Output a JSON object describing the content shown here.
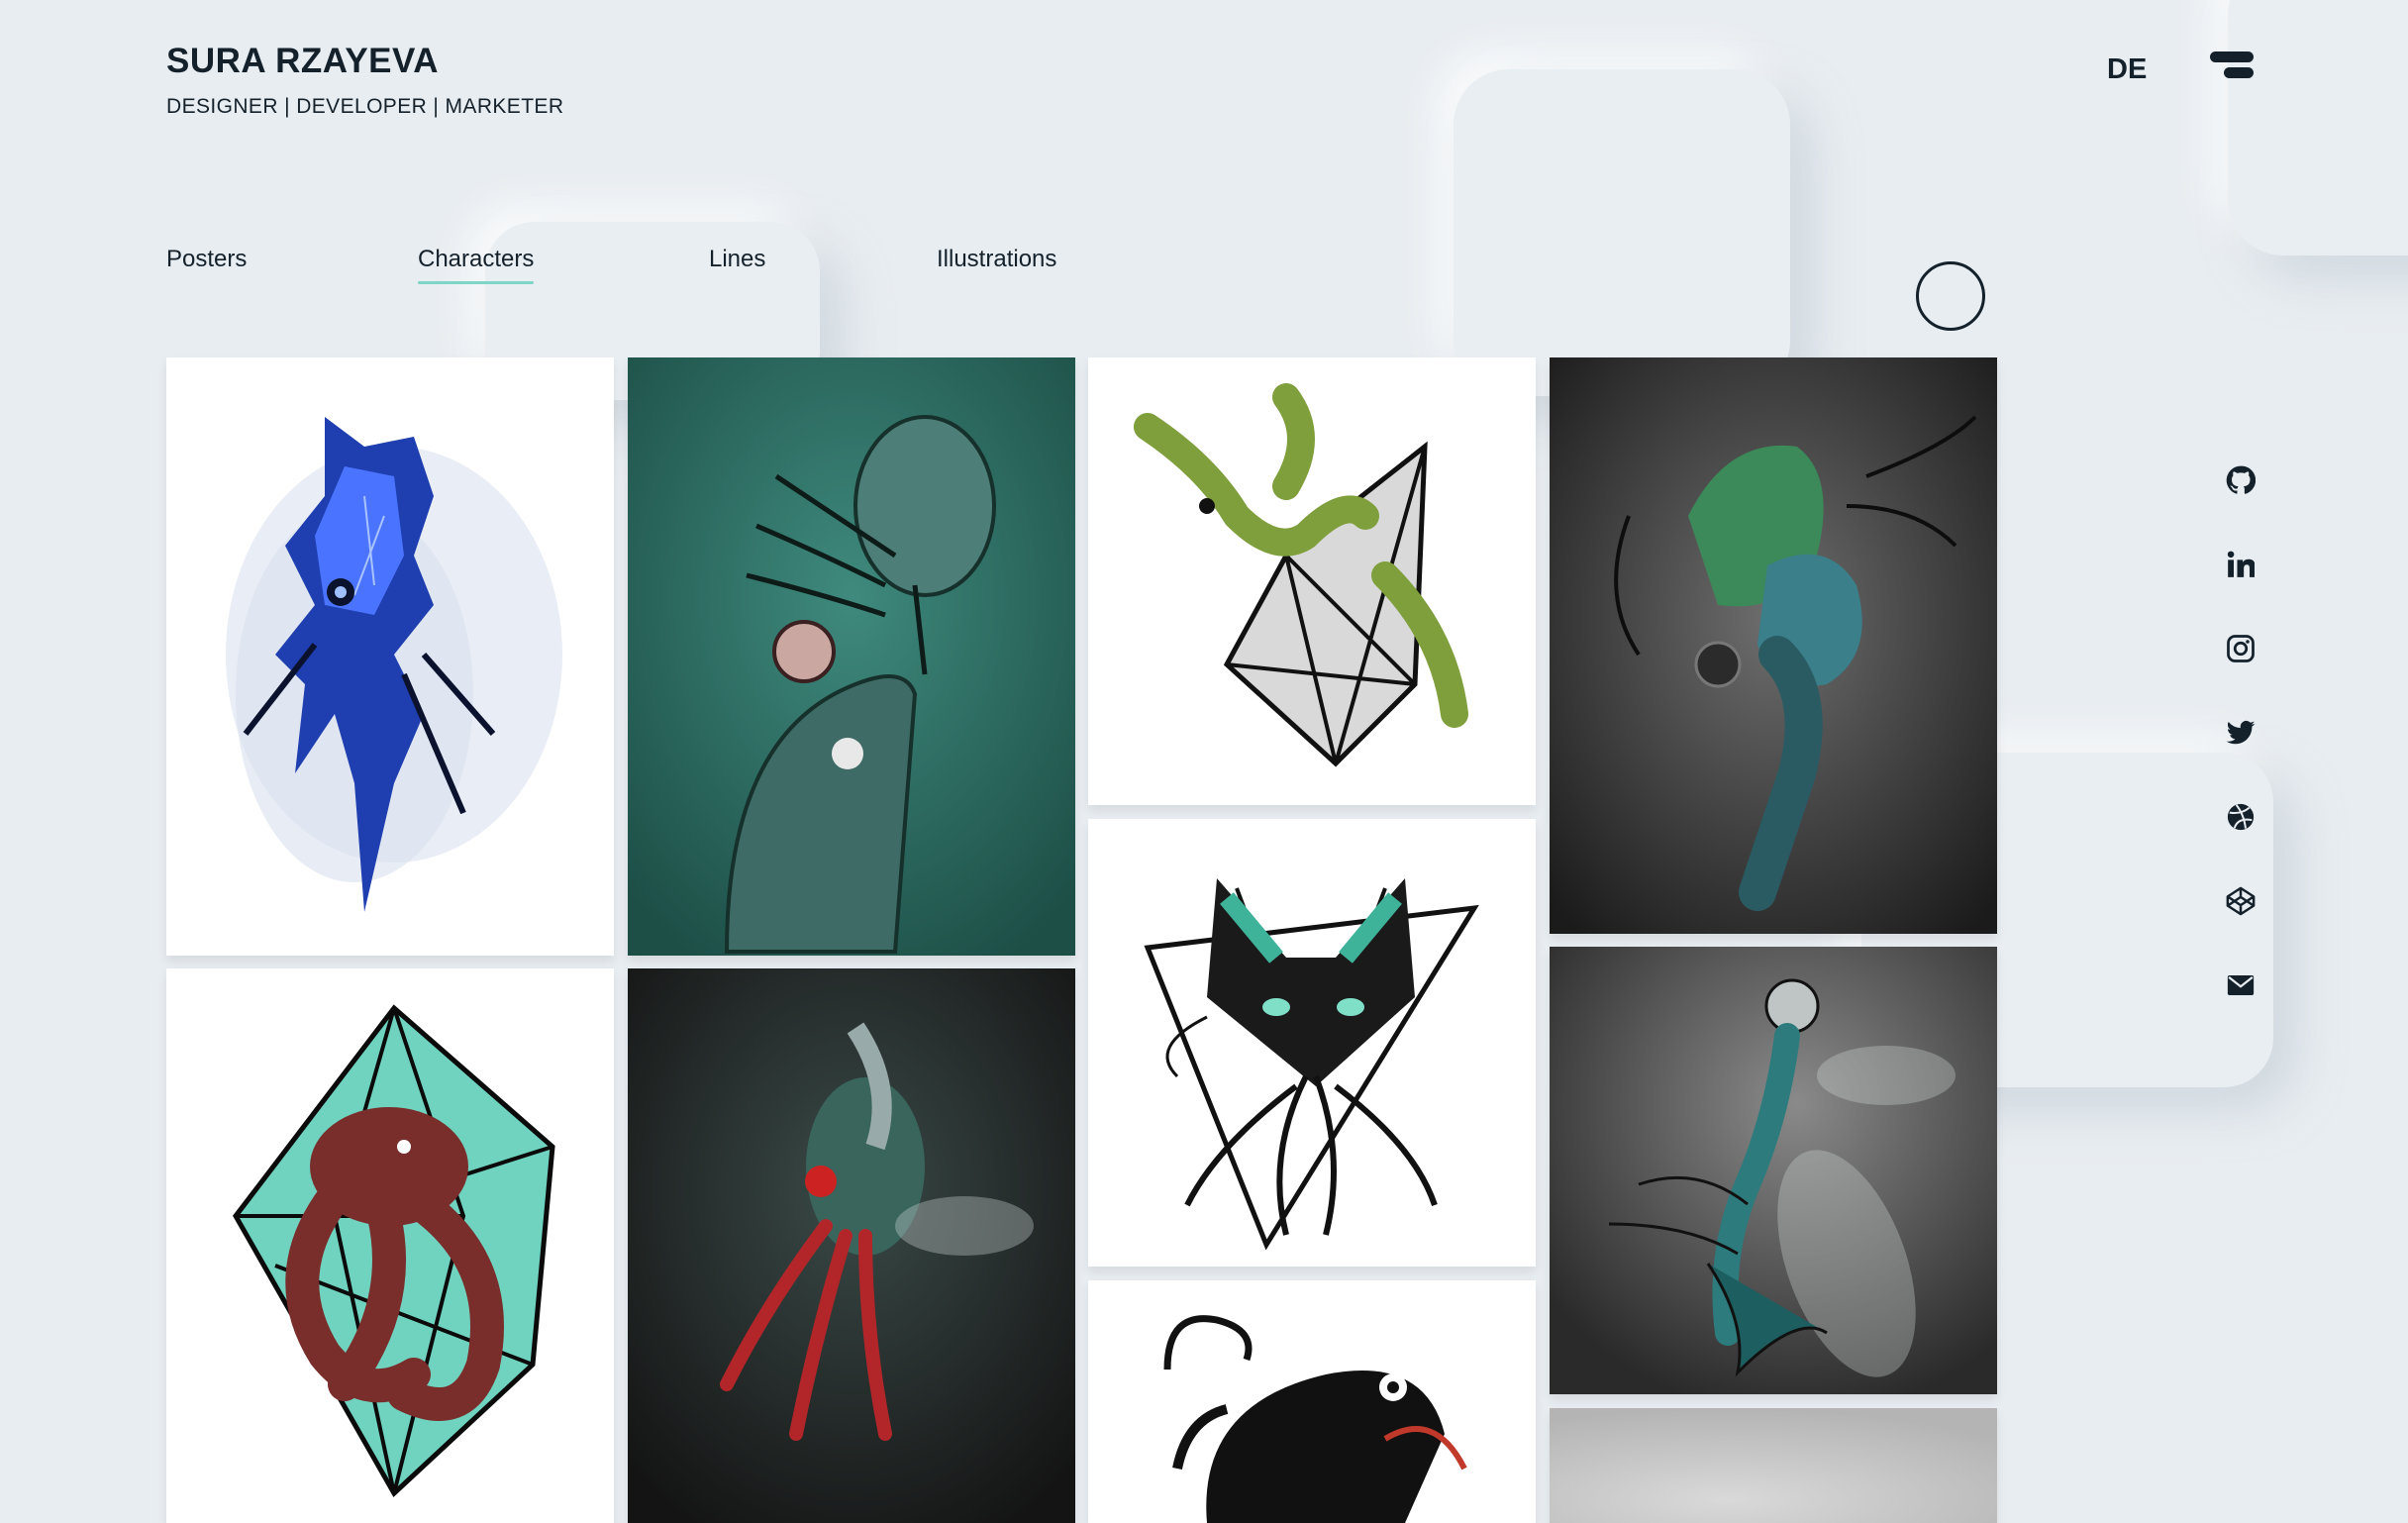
{
  "header": {
    "name": "SURA RZAYEVA",
    "roles": "DESIGNER | DEVELOPER | MARKETER"
  },
  "lang_toggle": "DE",
  "tabs": [
    {
      "label": "Posters",
      "active": false
    },
    {
      "label": "Characters",
      "active": true
    },
    {
      "label": "Lines",
      "active": false
    },
    {
      "label": "Illustrations",
      "active": false
    }
  ],
  "accent_color": "#7fd6c7",
  "social_links": [
    {
      "icon": "github-icon"
    },
    {
      "icon": "linkedin-icon"
    },
    {
      "icon": "instagram-icon"
    },
    {
      "icon": "twitter-icon"
    },
    {
      "icon": "dribbble-icon"
    },
    {
      "icon": "codepen-icon"
    },
    {
      "icon": "mail-icon"
    }
  ],
  "gallery": [
    {
      "subject": "blue-ink-creature"
    },
    {
      "subject": "teal-alien-figure"
    },
    {
      "subject": "green-lizard-geometric"
    },
    {
      "subject": "twin-faced-seahorse"
    },
    {
      "subject": "octopus-diamond"
    },
    {
      "subject": "tentacled-insect"
    },
    {
      "subject": "sphynx-cat-triangle"
    },
    {
      "subject": "dragonfly-skull-creature"
    },
    {
      "subject": "chameleon"
    },
    {
      "subject": "grey-artwork-partial"
    }
  ]
}
